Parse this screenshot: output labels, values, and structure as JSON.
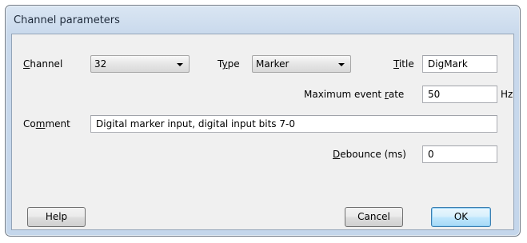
{
  "window": {
    "title": "Channel parameters"
  },
  "channel": {
    "label_pre": "",
    "label_ul": "C",
    "label_post": "hannel",
    "value": "32"
  },
  "type": {
    "label_pre": "T",
    "label_ul": "y",
    "label_post": "pe",
    "value": "Marker"
  },
  "title_field": {
    "label_pre": "",
    "label_ul": "T",
    "label_post": "itle",
    "value": "DigMark"
  },
  "max_rate": {
    "label_pre": "Maximum event ",
    "label_ul": "r",
    "label_post": "ate",
    "value": "50",
    "unit": "Hz"
  },
  "comment": {
    "label_pre": "Co",
    "label_ul": "m",
    "label_post": "ment",
    "value": "Digital marker input, digital input bits 7-0"
  },
  "debounce": {
    "label_pre": "",
    "label_ul": "D",
    "label_post": "ebounce (ms)",
    "value": "0"
  },
  "buttons": {
    "help": "Help",
    "cancel": "Cancel",
    "ok": "OK"
  }
}
